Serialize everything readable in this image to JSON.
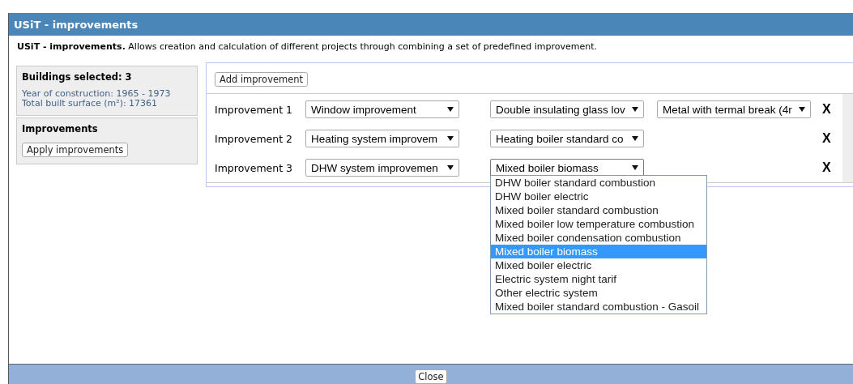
{
  "window": {
    "title": "USiT - improvements"
  },
  "description": {
    "lead": "USiT - improvements.",
    "text": "Allows creation and calculation of different projects through combining a set of predefined improvement."
  },
  "buildings": {
    "heading": "Buildings selected: 3",
    "lines": [
      "Year of construction: 1965 - 1973",
      "Total built surface (m²): 17361"
    ]
  },
  "improvements_panel": {
    "heading": "Improvements",
    "button": "Apply improvements"
  },
  "add_button": "Add improvement",
  "rows": [
    {
      "label": "Improvement 1",
      "selects": [
        {
          "value": "Window improvement",
          "open": false
        },
        {
          "value": "Double insulating glass lov",
          "open": false
        },
        {
          "value": "Metal with termal break (4r",
          "open": false
        }
      ],
      "remove": "X"
    },
    {
      "label": "Improvement 2",
      "selects": [
        {
          "value": "Heating system improvem",
          "open": false
        },
        {
          "value": "Heating boiler standard co",
          "open": false
        }
      ],
      "remove": "X"
    },
    {
      "label": "Improvement 3",
      "selects": [
        {
          "value": "DHW system improvemen",
          "open": false
        },
        {
          "value": "Mixed boiler biomass",
          "open": true
        }
      ],
      "remove": "X"
    }
  ],
  "dropdown": {
    "options": [
      {
        "label": "DHW boiler standard combustion",
        "selected": false
      },
      {
        "label": "DHW boiler electric",
        "selected": false
      },
      {
        "label": "Mixed boiler standard combustion",
        "selected": false
      },
      {
        "label": "Mixed boiler low temperature combustion",
        "selected": false
      },
      {
        "label": "Mixed boiler condensation combustion",
        "selected": false
      },
      {
        "label": "Mixed boiler biomass",
        "selected": true
      },
      {
        "label": "Mixed boiler electric",
        "selected": false
      },
      {
        "label": "Electric system night tarif",
        "selected": false
      },
      {
        "label": "Other electric system",
        "selected": false
      },
      {
        "label": "Mixed boiler standard combustion - Gasoil",
        "selected": false
      }
    ]
  },
  "footer": {
    "button": "Close"
  }
}
